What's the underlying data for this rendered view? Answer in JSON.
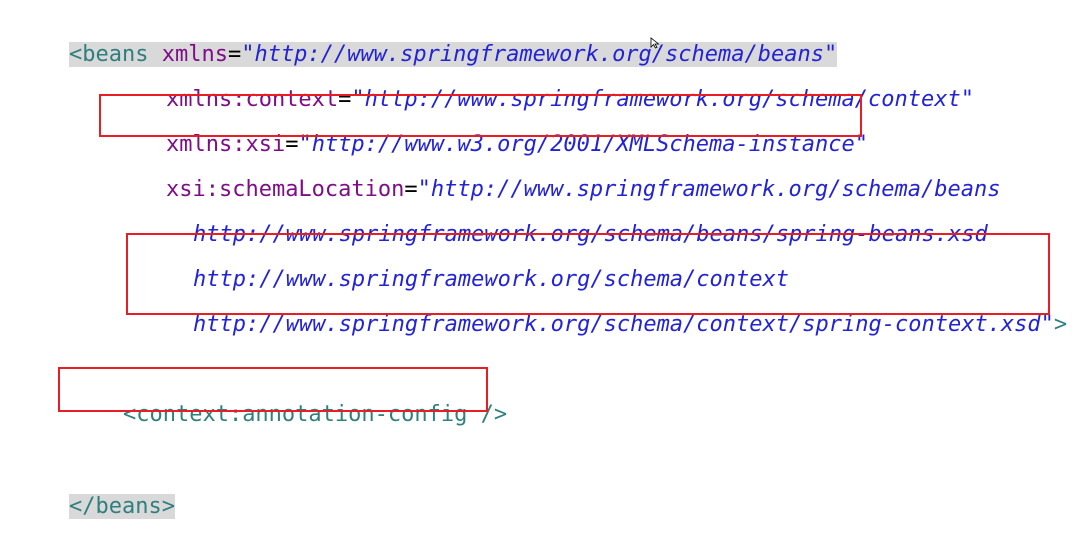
{
  "code": {
    "line1": {
      "open": "<",
      "tag": "beans",
      "attr": "xmlns",
      "eq": "=",
      "value": "\"http://www.springframework.org/schema/beans\""
    },
    "line2": {
      "attr": "xmlns:context",
      "eq": "=",
      "value": "\"http://www.springframework.org/schema/context\""
    },
    "line3": {
      "attr": "xmlns:xsi",
      "eq": "=",
      "value": "\"http://www.w3.org/2001/XMLSchema-instance\""
    },
    "line4": {
      "attr": "xsi:schemaLocation",
      "eq": "=",
      "value": "\"http://www.springframework.org/schema/beans"
    },
    "line5": {
      "value": "http://www.springframework.org/schema/beans/spring-beans.xsd"
    },
    "line6": {
      "value": "http://www.springframework.org/schema/context"
    },
    "line7": {
      "value": "http://www.springframework.org/schema/context/spring-context.xsd\"",
      "close": ">"
    },
    "line9": {
      "text": "<context:annotation-config />"
    },
    "line11": {
      "open": "</",
      "tag": "beans",
      "close": ">"
    }
  },
  "colors": {
    "tag": "#2f7f7f",
    "attribute": "#7f0d89",
    "string": "#2323d6",
    "highlight_box": "#e81e25",
    "selection": "#d9d9d9"
  }
}
